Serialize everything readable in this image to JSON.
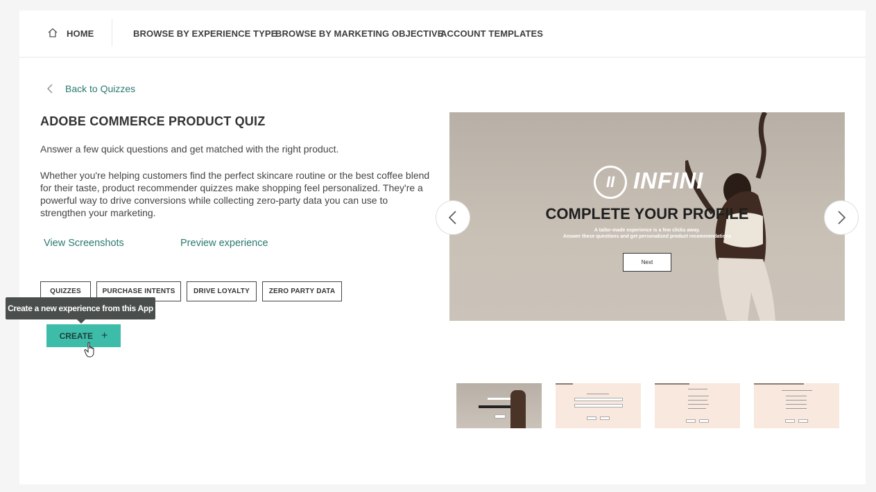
{
  "nav": {
    "home": "HOME",
    "browse_experience": "BROWSE BY EXPERIENCE TYPE",
    "browse_objective": "BROWSE BY MARKETING OBJECTIVE",
    "account_templates": "ACCOUNT TEMPLATES"
  },
  "back_link": "Back to Quizzes",
  "title": "ADOBE COMMERCE PRODUCT QUIZ",
  "description_short": "Answer a few quick questions and get matched with the right product.",
  "description_long": "Whether you're helping customers find the perfect skincare routine or the best coffee blend for their taste, product recommender quizzes make shopping feel personalized. They're a powerful way to drive conversions while collecting zero-party data you can use to strengthen your marketing.",
  "links": {
    "screenshots": "View Screenshots",
    "preview": "Preview experience"
  },
  "tags": [
    "QUIZZES",
    "PURCHASE INTENTS",
    "DRIVE LOYALTY",
    "ZERO PARTY DATA"
  ],
  "tooltip": "Create a new experience from this App",
  "create_button": "CREATE",
  "create_icon": "+",
  "preview": {
    "logo_mark": "II",
    "logo_text": "INFINI",
    "heading": "COMPLETE YOUR PROFILE",
    "sub1": "A tailor-made experience is a few clicks away.",
    "sub2": "Answer these questions and get personalized product recommendations",
    "next": "Next"
  },
  "colors": {
    "accent": "#3dbca9",
    "link": "#2a7a70",
    "tooltip_bg": "#4a4f4e"
  }
}
